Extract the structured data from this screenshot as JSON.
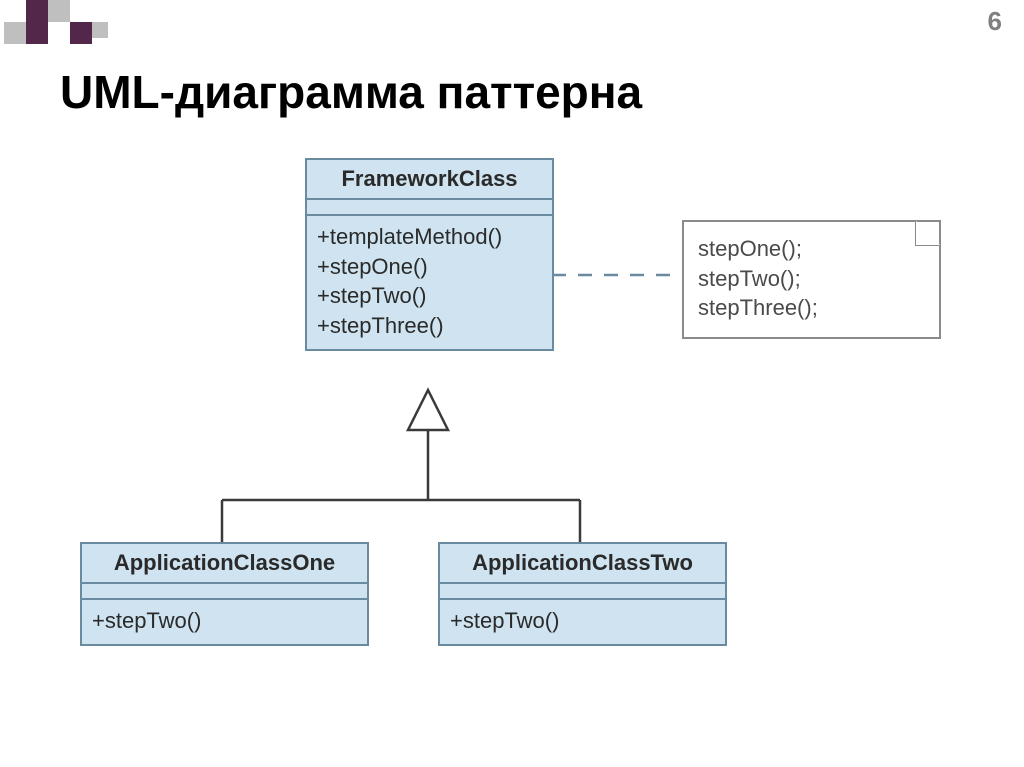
{
  "slide": {
    "number": "6",
    "title": "UML-диаграмма паттерна"
  },
  "framework": {
    "name": "FrameworkClass",
    "ops": [
      "+templateMethod()",
      "+stepOne()",
      "+stepTwo()",
      "+stepThree()"
    ]
  },
  "note": {
    "lines": [
      "stepOne();",
      "stepTwo();",
      "stepThree();"
    ]
  },
  "app1": {
    "name": "ApplicationClassOne",
    "ops": [
      "+stepTwo()"
    ]
  },
  "app2": {
    "name": "ApplicationClassTwo",
    "ops": [
      "+stepTwo()"
    ]
  }
}
